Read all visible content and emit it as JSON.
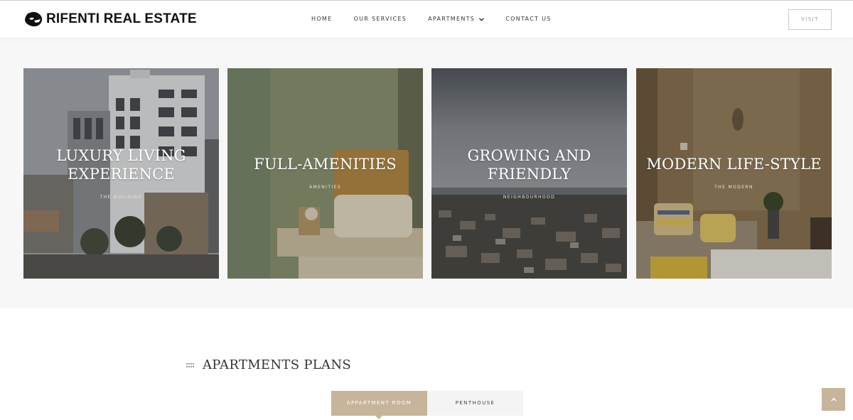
{
  "header": {
    "logo_icon": "panther-head-icon",
    "logo_text": "RIFENTI REAL ESTATE",
    "nav": [
      {
        "label": "HOME"
      },
      {
        "label": "OUR SERVICES"
      },
      {
        "label": "APARTMENTS",
        "has_dropdown": true
      },
      {
        "label": "CONTACT US"
      }
    ],
    "visit_label": "VISIT"
  },
  "features": [
    {
      "title_line1": "LUXURY LIVING",
      "title_line2": "EXPERIENCE",
      "subtitle": "THE BUILDING"
    },
    {
      "title_line1": "FULL-AMENITIES",
      "title_line2": "",
      "subtitle": "AMENITIES"
    },
    {
      "title_line1": "GROWING AND",
      "title_line2": "FRIENDLY",
      "subtitle": "NEIGHBOURHOOD"
    },
    {
      "title_line1": "MODERN LIFE-STYLE",
      "title_line2": "",
      "subtitle": "THE MODERN"
    }
  ],
  "plans": {
    "title": "APARTMENTS PLANS",
    "tabs": [
      {
        "label": "APPARTMENT ROOM",
        "active": true
      },
      {
        "label": "PENTHOUSE",
        "active": false
      }
    ]
  },
  "scroll_top_icon": "chevron-up-icon",
  "colors": {
    "accent": "#c6b59a",
    "band_background": "#f7f7f7",
    "header_background": "#ffffff"
  }
}
